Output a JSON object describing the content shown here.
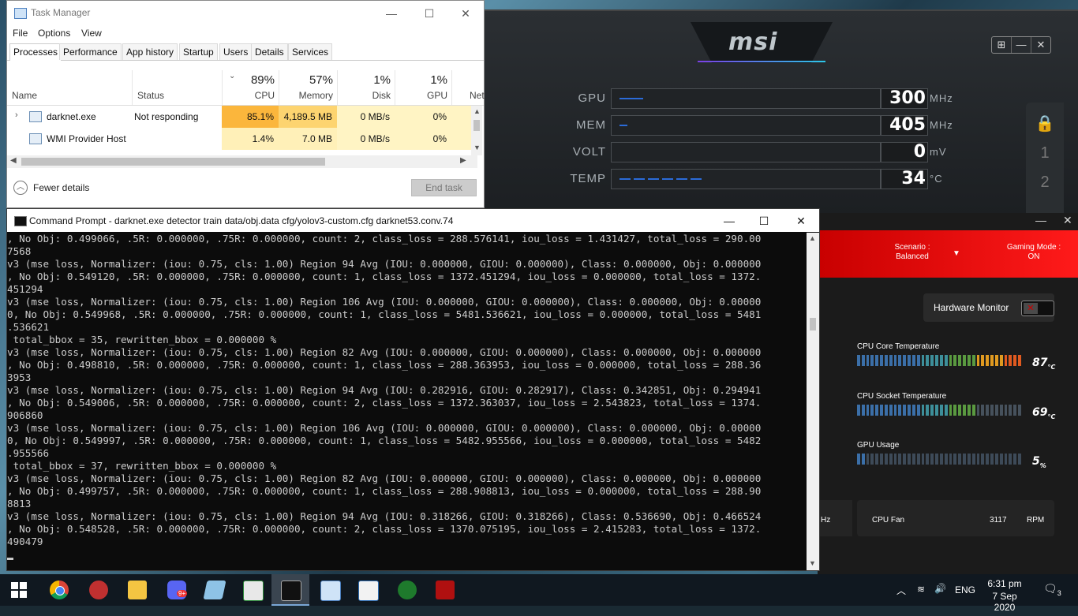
{
  "task_manager": {
    "title": "Task Manager",
    "menu": [
      "File",
      "Options",
      "View"
    ],
    "tabs": [
      "Processes",
      "Performance",
      "App history",
      "Startup",
      "Users",
      "Details",
      "Services"
    ],
    "active_tab": "Processes",
    "columns": {
      "name": "Name",
      "status": "Status",
      "cpu": {
        "pct": "89%",
        "label": "CPU"
      },
      "memory": {
        "pct": "57%",
        "label": "Memory"
      },
      "disk": {
        "pct": "1%",
        "label": "Disk"
      },
      "gpu": {
        "pct": "1%",
        "label": "GPU"
      },
      "net": "Net"
    },
    "rows": [
      {
        "name": "darknet.exe",
        "status": "Not responding",
        "cpu": "85.1%",
        "memory": "4,189.5 MB",
        "disk": "0 MB/s",
        "gpu": "0%"
      },
      {
        "name": "WMI Provider Host",
        "status": "",
        "cpu": "1.4%",
        "memory": "7.0 MB",
        "disk": "0 MB/s",
        "gpu": "0%"
      }
    ],
    "fewer_details": "Fewer details",
    "end_task": "End task"
  },
  "afterburner": {
    "logo": "msi",
    "rows": [
      {
        "label": "GPU",
        "value": "300",
        "unit": "MHz"
      },
      {
        "label": "MEM",
        "value": "405",
        "unit": "MHz"
      },
      {
        "label": "VOLT",
        "value": "0",
        "unit": "mV"
      },
      {
        "label": "TEMP",
        "value": "34",
        "unit": "°C"
      }
    ],
    "side": [
      "1",
      "2"
    ]
  },
  "dragon_center": {
    "scenario_label": "Scenario :",
    "scenario_value": "Balanced",
    "gaming_mode_label": "Gaming Mode :",
    "gaming_mode_value": "ON",
    "hardware_monitor": "Hardware Monitor",
    "metrics": [
      {
        "label": "CPU Core Temperature",
        "value": "87",
        "unit": "°C"
      },
      {
        "label": "CPU Socket Temperature",
        "value": "69",
        "unit": "°C"
      },
      {
        "label": "GPU Usage",
        "value": "5",
        "unit": "%"
      }
    ],
    "left_unit": "Hz",
    "fan_label": "CPU Fan",
    "fan_value": "3117",
    "fan_unit": "RPM"
  },
  "cmd": {
    "title": "Command Prompt - darknet.exe  detector train data/obj.data cfg/yolov3-custom.cfg darknet53.conv.74",
    "lines": [
      ", No Obj: 0.499066, .5R: 0.000000, .75R: 0.000000, count: 2, class_loss = 288.576141, iou_loss = 1.431427, total_loss = 290.00",
      "7568",
      "v3 (mse loss, Normalizer: (iou: 0.75, cls: 1.00) Region 94 Avg (IOU: 0.000000, GIOU: 0.000000), Class: 0.000000, Obj: 0.000000",
      ", No Obj: 0.549120, .5R: 0.000000, .75R: 0.000000, count: 1, class_loss = 1372.451294, iou_loss = 0.000000, total_loss = 1372.",
      "451294",
      "v3 (mse loss, Normalizer: (iou: 0.75, cls: 1.00) Region 106 Avg (IOU: 0.000000, GIOU: 0.000000), Class: 0.000000, Obj: 0.00000",
      "0, No Obj: 0.549968, .5R: 0.000000, .75R: 0.000000, count: 1, class_loss = 5481.536621, iou_loss = 0.000000, total_loss = 5481",
      ".536621",
      " total_bbox = 35, rewritten_bbox = 0.000000 %",
      "v3 (mse loss, Normalizer: (iou: 0.75, cls: 1.00) Region 82 Avg (IOU: 0.000000, GIOU: 0.000000), Class: 0.000000, Obj: 0.000000",
      ", No Obj: 0.498810, .5R: 0.000000, .75R: 0.000000, count: 1, class_loss = 288.363953, iou_loss = 0.000000, total_loss = 288.36",
      "3953",
      "v3 (mse loss, Normalizer: (iou: 0.75, cls: 1.00) Region 94 Avg (IOU: 0.282916, GIOU: 0.282917), Class: 0.342851, Obj: 0.294941",
      ", No Obj: 0.549006, .5R: 0.000000, .75R: 0.000000, count: 2, class_loss = 1372.363037, iou_loss = 2.543823, total_loss = 1374.",
      "906860",
      "v3 (mse loss, Normalizer: (iou: 0.75, cls: 1.00) Region 106 Avg (IOU: 0.000000, GIOU: 0.000000), Class: 0.000000, Obj: 0.00000",
      "0, No Obj: 0.549997, .5R: 0.000000, .75R: 0.000000, count: 1, class_loss = 5482.955566, iou_loss = 0.000000, total_loss = 5482",
      ".955566",
      " total_bbox = 37, rewritten_bbox = 0.000000 %",
      "v3 (mse loss, Normalizer: (iou: 0.75, cls: 1.00) Region 82 Avg (IOU: 0.000000, GIOU: 0.000000), Class: 0.000000, Obj: 0.000000",
      ", No Obj: 0.499757, .5R: 0.000000, .75R: 0.000000, count: 1, class_loss = 288.908813, iou_loss = 0.000000, total_loss = 288.90",
      "8813",
      "v3 (mse loss, Normalizer: (iou: 0.75, cls: 1.00) Region 94 Avg (IOU: 0.318266, GIOU: 0.318266), Class: 0.536690, Obj: 0.466524",
      ", No Obj: 0.548528, .5R: 0.000000, .75R: 0.000000, count: 2, class_loss = 1370.075195, iou_loss = 2.415283, total_loss = 1372.",
      "490479"
    ]
  },
  "taskbar": {
    "apps": [
      "windows-start",
      "chrome",
      "app-red",
      "file-explorer",
      "discord",
      "app-notes",
      "app-sheet",
      "cmd",
      "task-manager",
      "app-window",
      "app-green",
      "app-red-game"
    ],
    "discord_badge": "9+",
    "language": "ENG",
    "time": "6:31 pm",
    "date": "7 Sep 2020",
    "notifications": "3"
  }
}
